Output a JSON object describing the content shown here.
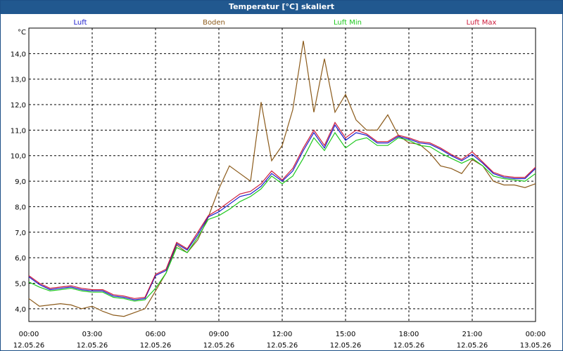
{
  "window": {
    "title": "Temperatur [°C] skaliert"
  },
  "chart_data": {
    "type": "line",
    "title": "Temperatur [°C] skaliert",
    "ylabel": "°C",
    "xlabel": "",
    "ylim": [
      3.5,
      15.0
    ],
    "grid": true,
    "legend_position": "top",
    "y_ticks": [
      "4,0",
      "5,0",
      "6,0",
      "7,0",
      "8,0",
      "9,0",
      "10,0",
      "11,0",
      "12,0",
      "13,0",
      "14,0"
    ],
    "x_ticks": [
      {
        "time": "00:00",
        "date": "12.05.26"
      },
      {
        "time": "03:00",
        "date": "12.05.26"
      },
      {
        "time": "06:00",
        "date": "12.05.26"
      },
      {
        "time": "09:00",
        "date": "12.05.26"
      },
      {
        "time": "12:00",
        "date": "12.05.26"
      },
      {
        "time": "15:00",
        "date": "12.05.26"
      },
      {
        "time": "18:00",
        "date": "12.05.26"
      },
      {
        "time": "21:00",
        "date": "12.05.26"
      },
      {
        "time": "00:00",
        "date": "13.05.26"
      }
    ],
    "x_hours": [
      0,
      0.5,
      1,
      1.5,
      2,
      2.5,
      3,
      3.5,
      4,
      4.5,
      5,
      5.5,
      6,
      6.5,
      7,
      7.5,
      8,
      8.5,
      9,
      9.5,
      10,
      10.5,
      11,
      11.5,
      12,
      12.5,
      13,
      13.5,
      14,
      14.5,
      15,
      15.5,
      16,
      16.5,
      17,
      17.5,
      18,
      18.5,
      19,
      19.5,
      20,
      20.5,
      21,
      21.5,
      22,
      22.5,
      23,
      23.5,
      24
    ],
    "series": [
      {
        "name": "Luft",
        "color": "#1a1acc",
        "values": [
          5.25,
          4.95,
          4.75,
          4.8,
          4.85,
          4.75,
          4.7,
          4.7,
          4.5,
          4.45,
          4.35,
          4.4,
          5.3,
          5.5,
          6.55,
          6.3,
          6.9,
          7.6,
          7.8,
          8.1,
          8.4,
          8.5,
          8.8,
          9.3,
          9.0,
          9.4,
          10.2,
          10.9,
          10.3,
          11.2,
          10.6,
          10.9,
          10.8,
          10.5,
          10.5,
          10.75,
          10.65,
          10.5,
          10.45,
          10.25,
          10.0,
          9.8,
          10.05,
          9.7,
          9.3,
          9.15,
          9.1,
          9.1,
          9.5
        ]
      },
      {
        "name": "Boden",
        "color": "#8b5a1a",
        "values": [
          4.4,
          4.1,
          4.15,
          4.2,
          4.15,
          4.0,
          4.1,
          3.9,
          3.75,
          3.7,
          3.85,
          4.0,
          4.7,
          5.4,
          6.5,
          6.2,
          6.7,
          7.6,
          8.7,
          9.6,
          9.3,
          9.0,
          12.1,
          9.8,
          10.4,
          11.8,
          14.5,
          11.7,
          13.8,
          11.7,
          12.4,
          11.4,
          11.0,
          11.0,
          11.6,
          10.8,
          10.5,
          10.45,
          10.1,
          9.6,
          9.5,
          9.3,
          9.85,
          9.6,
          9.0,
          8.85,
          8.85,
          8.75,
          8.9
        ]
      },
      {
        "name": "Luft Min",
        "color": "#1ec81e",
        "values": [
          5.05,
          4.85,
          4.7,
          4.75,
          4.8,
          4.7,
          4.65,
          4.65,
          4.45,
          4.4,
          4.3,
          4.35,
          4.8,
          5.4,
          6.4,
          6.2,
          6.8,
          7.5,
          7.65,
          7.9,
          8.2,
          8.4,
          8.7,
          9.2,
          8.9,
          9.2,
          9.9,
          10.7,
          10.2,
          10.9,
          10.3,
          10.6,
          10.7,
          10.4,
          10.4,
          10.7,
          10.6,
          10.4,
          10.35,
          10.1,
          9.9,
          9.7,
          9.9,
          9.6,
          9.2,
          9.1,
          9.05,
          9.0,
          9.3
        ]
      },
      {
        "name": "Luft Max",
        "color": "#cc1a3a",
        "values": [
          5.3,
          5.0,
          4.8,
          4.85,
          4.9,
          4.8,
          4.75,
          4.75,
          4.55,
          4.5,
          4.4,
          4.45,
          5.35,
          5.55,
          6.6,
          6.35,
          7.0,
          7.65,
          7.9,
          8.2,
          8.5,
          8.6,
          8.9,
          9.4,
          9.05,
          9.5,
          10.3,
          11.0,
          10.4,
          11.3,
          10.7,
          11.0,
          10.85,
          10.55,
          10.55,
          10.8,
          10.7,
          10.55,
          10.5,
          10.3,
          10.05,
          9.85,
          10.15,
          9.75,
          9.35,
          9.2,
          9.15,
          9.15,
          9.55
        ]
      }
    ]
  }
}
